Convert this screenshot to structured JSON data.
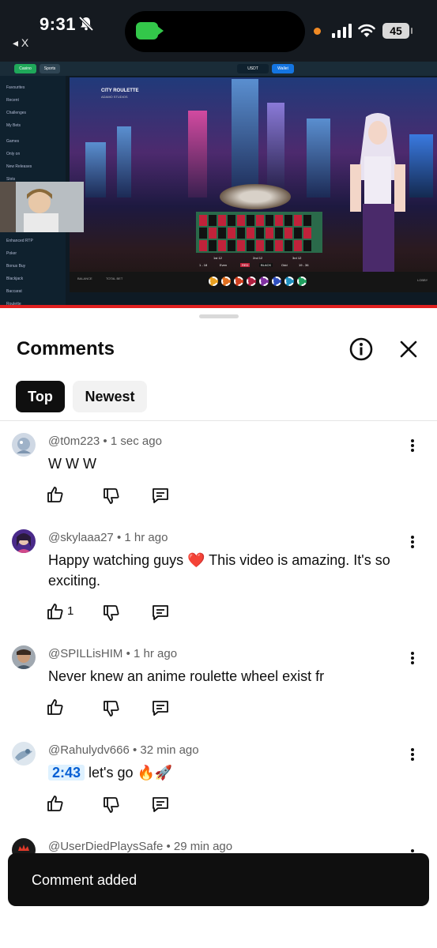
{
  "status_bar": {
    "time": "9:31",
    "back_label": "◂ X",
    "battery": "45"
  },
  "video": {
    "site_tabs": [
      "Casino",
      "Sports"
    ],
    "site_wallet_label": "Wallet",
    "site_currency": "USDT",
    "sidebar_items": [
      "Favourites",
      "Recent",
      "Challenges",
      "My Bets",
      "Games",
      "Only on",
      "New Releases",
      "Slots",
      "Enhanced RTP",
      "Poker",
      "Bonus Buy",
      "Blackjack",
      "Baccarat",
      "Roulette"
    ],
    "game_title": "CITY ROULETTE",
    "game_provider": "ADAMO STUDIOS",
    "board_labels": [
      "1st 12",
      "2nd 12",
      "3rd 12",
      "1 - 18",
      "Even",
      "RED",
      "BLACK",
      "Odd",
      "19 - 36"
    ],
    "balance_label": "BALANCE",
    "total_bet_label": "TOTAL BET",
    "lobby_label": "LOBBY"
  },
  "sheet": {
    "title": "Comments",
    "filter_chips": [
      "Top",
      "Newest"
    ],
    "selected_filter": "Top"
  },
  "comments": [
    {
      "author": "@t0m223",
      "time": "1 sec ago",
      "text": "W W W",
      "likes": ""
    },
    {
      "author": "@skylaaa27",
      "time": "1 hr ago",
      "text": "Happy watching guys ❤️ This video is amazing. It's so exciting.",
      "likes": "1"
    },
    {
      "author": "@SPILLisHIM",
      "time": "1 hr ago",
      "text": "Never knew an anime roulette wheel exist fr",
      "likes": ""
    },
    {
      "author": "@Rahulydv666",
      "time": "32 min ago",
      "timestamp_link": "2:43",
      "text": "let's go 🔥🚀",
      "likes": ""
    },
    {
      "author": "@UserDiedPlaysSafe",
      "time": "29 min ago",
      "text": "",
      "likes": ""
    }
  ],
  "toast": {
    "message": "Comment added"
  },
  "colors": {
    "status_bar_bg": "#151a20",
    "accent_blue": "#065fd4",
    "timestamp_bg": "#def1ff",
    "chip_selected_bg": "#0f0f0f",
    "chip_bg": "#f2f2f2",
    "toast_bg": "#0f0f0f",
    "progress_red": "#e02020"
  }
}
